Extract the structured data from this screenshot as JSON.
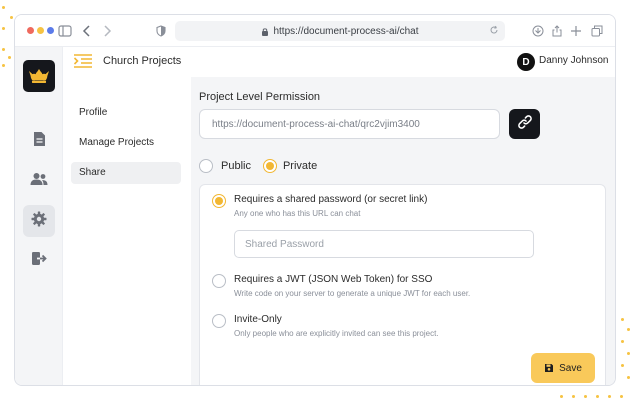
{
  "browser": {
    "url": "https://document-process-ai/chat",
    "traffic_colors": [
      "#ef6a5e",
      "#f6c343",
      "#5b7bea"
    ]
  },
  "header": {
    "project_title": "Church Projects",
    "avatar_initial": "D",
    "user_name": "Danny Johnson"
  },
  "sidebar": {
    "items": [
      {
        "label": "Profile"
      },
      {
        "label": "Manage Projects"
      },
      {
        "label": "Share"
      }
    ]
  },
  "main": {
    "section_label": "Project Level Permission",
    "share_link": "https://document-process-ai-chat/qrc2vjim3400",
    "visibility": {
      "public_label": "Public",
      "private_label": "Private",
      "selected": "Private"
    },
    "options": [
      {
        "title": "Requires a shared password (or secret link)",
        "desc": "Any one who has this URL can chat",
        "selected": true
      },
      {
        "title": "Requires a JWT (JSON Web Token) for SSO",
        "desc": "Write code on your server to generate a unique JWT for each user.",
        "selected": false
      },
      {
        "title": "Invite-Only",
        "desc": "Only people who are explicitly invited can see this project.",
        "selected": false
      }
    ],
    "password_placeholder": "Shared Password",
    "save_label": "Save"
  },
  "colors": {
    "accent": "#f2b733",
    "save_button": "#f9c95a",
    "dark": "#15171c"
  }
}
